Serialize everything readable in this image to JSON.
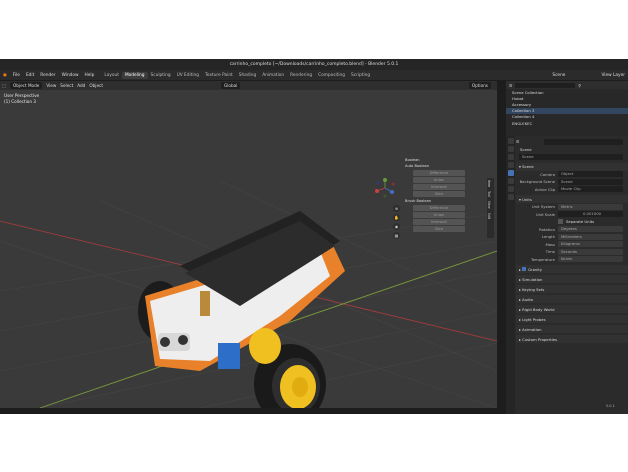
{
  "window": {
    "title": "carrinho_completo [~/Downloads/carrinho_completo.blend] - Blender 5.0.1"
  },
  "menu": [
    "File",
    "Edit",
    "Render",
    "Window",
    "Help"
  ],
  "workspaces": [
    "Layout",
    "Modeling",
    "Sculpting",
    "UV Editing",
    "Texture Paint",
    "Shading",
    "Animation",
    "Rendering",
    "Compositing",
    "Scripting"
  ],
  "active_workspace": "Modeling",
  "scene_selector": "Scene",
  "view_layer": "View Layer",
  "viewport": {
    "mode": "Object Mode",
    "menus": [
      "View",
      "Select",
      "Add",
      "Object"
    ],
    "transform": "Global",
    "options_label": "Options",
    "perspective": "User Perspective",
    "collection": "(1) Collection 3"
  },
  "side_panel": {
    "boolean_title": "Boolean",
    "auto_boolean": "Auto Boolean",
    "auto_buttons": [
      "Difference",
      "Union",
      "Intersect",
      "Slice"
    ],
    "brush_boolean": "Brush Boolean",
    "brush_buttons": [
      "Difference",
      "Union",
      "Intersect",
      "Slice"
    ],
    "tabs": [
      "Item",
      "Tool",
      "View",
      "Edit"
    ]
  },
  "outliner": {
    "search": "",
    "rows": [
      "Scene Collection",
      "Hubot",
      "Accessory",
      "Collection 3",
      "Collection 4",
      "ENGLEKEC"
    ]
  },
  "properties": {
    "search_placeholder": "",
    "scene_label": "Scene",
    "scene_name": "Scene",
    "scene_section": "Scene",
    "camera_label": "Camera",
    "camera_val": "Object",
    "bg_scene_label": "Background Scene",
    "bg_scene_val": "Scene",
    "active_clip_label": "Active Clip",
    "active_clip_val": "Movie Clip",
    "units_section": "Units",
    "unit_system_label": "Unit System",
    "unit_system_val": "Metric",
    "unit_scale_label": "Unit Scale",
    "unit_scale_val": "0.001000",
    "separate_units": "Separate Units",
    "rotation_label": "Rotation",
    "rotation_val": "Degrees",
    "length_label": "Length",
    "length_val": "Millimeters",
    "mass_label": "Mass",
    "mass_val": "Kilograms",
    "time_label": "Time",
    "time_val": "Seconds",
    "temperature_label": "Temperature",
    "temperature_val": "Kelvin",
    "collapsed": [
      "Gravity",
      "Simulation",
      "Keying Sets",
      "Audio",
      "Rigid Body World",
      "Light Probes",
      "Animation",
      "Custom Properties"
    ]
  },
  "version": "5.0.1",
  "colors": {
    "accent": "#4772b3",
    "orange": "#e8812a",
    "yellow": "#f0c020",
    "chassis": "#f2f2f2",
    "bg": "#3a3a3a"
  }
}
